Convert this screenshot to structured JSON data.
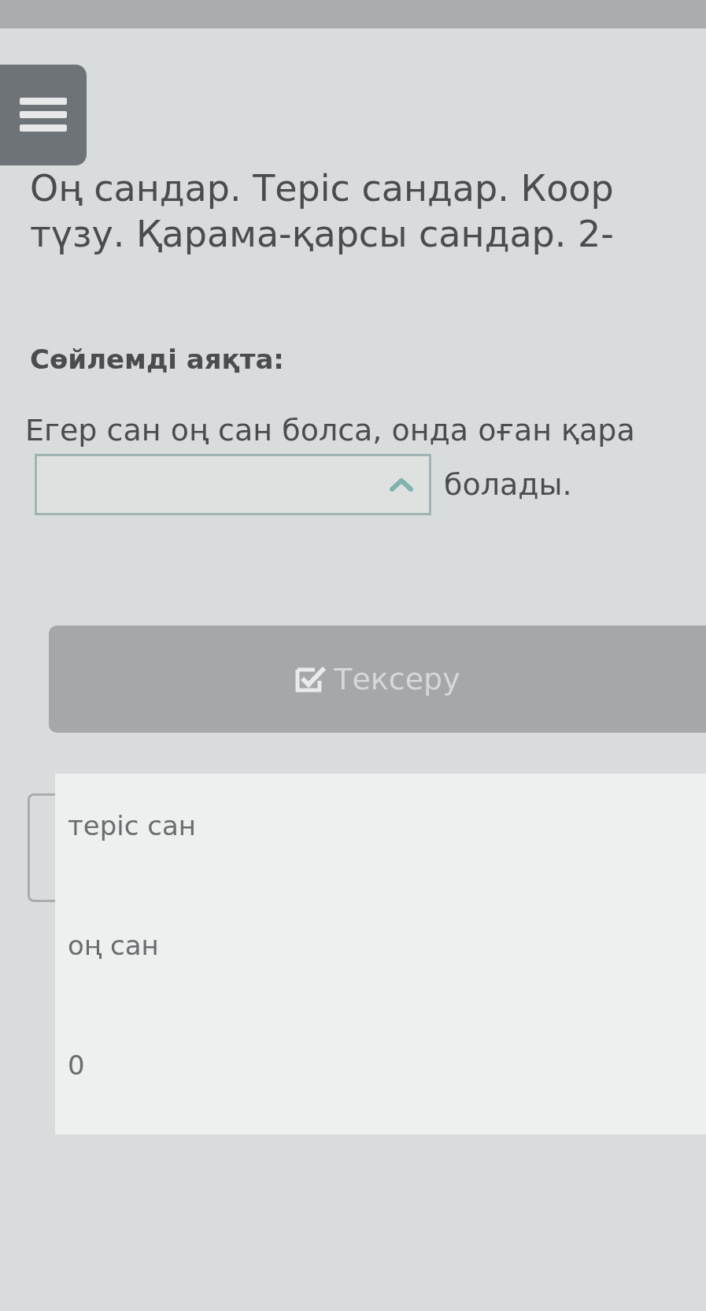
{
  "title_lines": [
    "Оң сандар. Теріс сандар. Коор",
    "түзу. Қарама-қарсы сандар. 2-"
  ],
  "instruction": "Сөйлемді аяқта:",
  "sentence": {
    "before": "Егер сан оң сан болса, онда оған қара",
    "dropdown": {
      "expanded": true
    },
    "after": "болады."
  },
  "check_button": {
    "label": "Тексеру",
    "disabled": true
  },
  "options": [
    {
      "label": "теріс сан",
      "selected": false
    },
    {
      "label": "оң сан",
      "selected": false
    },
    {
      "label": "0",
      "selected": false
    }
  ]
}
